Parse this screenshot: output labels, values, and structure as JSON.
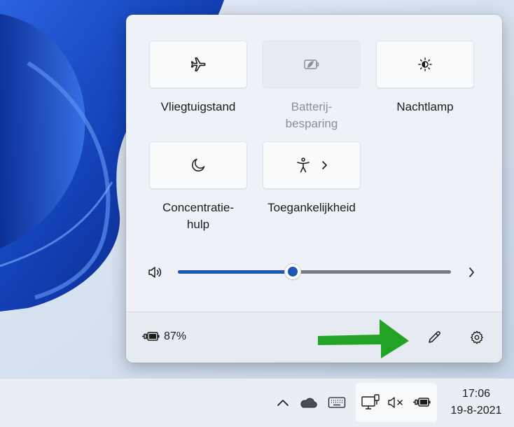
{
  "quick_settings": {
    "tiles": [
      {
        "label": "Vliegtuigstand",
        "icon": "airplane-icon",
        "enabled": true
      },
      {
        "label": "Batterij-\nbesparing",
        "icon": "battery-saver-icon",
        "enabled": false
      },
      {
        "label": "Nachtlamp",
        "icon": "brightness-icon",
        "enabled": true
      },
      {
        "label": "Concentratie-\nhulp",
        "icon": "moon-icon",
        "enabled": true
      },
      {
        "label": "Toegankelijkheid",
        "icon": "accessibility-icon",
        "enabled": true,
        "has_submenu": true
      }
    ],
    "volume": {
      "icon": "speaker-icon",
      "level_percent": 42
    },
    "battery": {
      "percent_text": "87%",
      "icon": "battery-charging-icon"
    },
    "footer_actions": [
      {
        "icon": "pencil-icon",
        "purpose": "edit"
      },
      {
        "icon": "gear-icon",
        "purpose": "settings"
      }
    ],
    "annotation": {
      "icon": "green-arrow",
      "color": "#22a325"
    }
  },
  "taskbar": {
    "tray_icons": [
      "chevron-up-icon",
      "onedrive-cloud-icon",
      "keyboard-icon"
    ],
    "status_icons": [
      "network-icon",
      "volume-muted-icon",
      "battery-charging-icon"
    ],
    "time": "17:06",
    "date": "19-8-2021"
  },
  "colors": {
    "accent": "#1b57b8",
    "arrow": "#22a325",
    "panel": "#eef2f8"
  }
}
